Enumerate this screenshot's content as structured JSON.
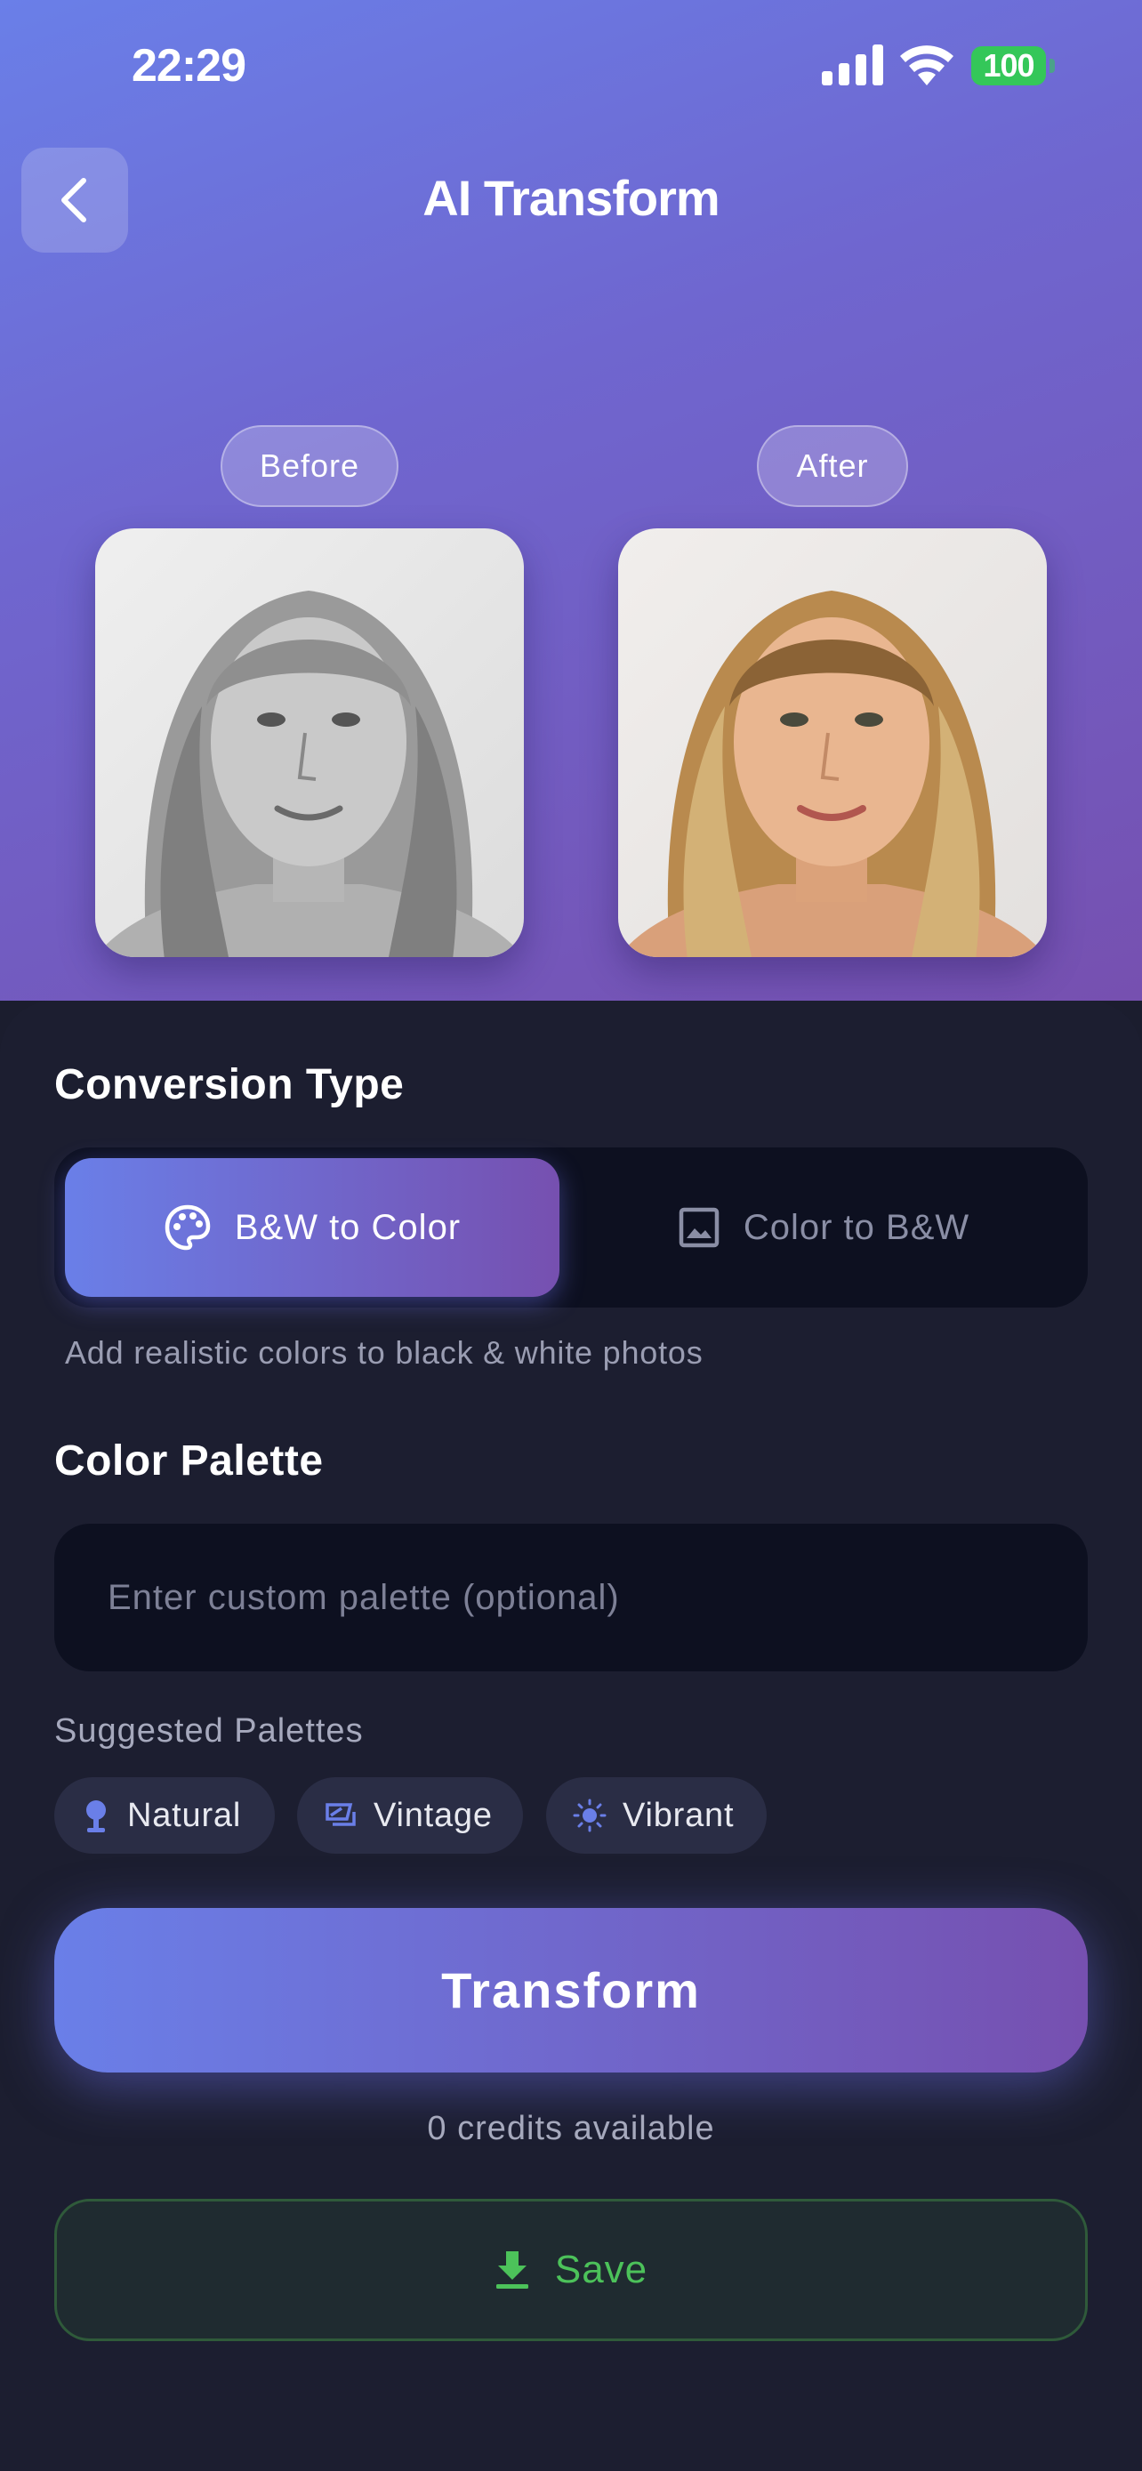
{
  "status_bar": {
    "time": "22:29",
    "battery": "100",
    "icons": [
      "signal-icon",
      "wifi-icon",
      "battery-icon"
    ]
  },
  "header": {
    "title": "AI Transform",
    "back_icon": "chevron-left-icon"
  },
  "preview": {
    "before_label": "Before",
    "after_label": "After"
  },
  "conversion": {
    "title": "Conversion Type",
    "options": [
      {
        "label": "B&W to Color",
        "icon": "palette-icon",
        "selected": true
      },
      {
        "label": "Color to B&W",
        "icon": "image-icon",
        "selected": false
      }
    ],
    "description": "Add realistic colors to black & white photos"
  },
  "palette": {
    "title": "Color Palette",
    "input_placeholder": "Enter custom palette (optional)",
    "input_value": "",
    "suggested_label": "Suggested Palettes",
    "suggestions": [
      {
        "label": "Natural",
        "icon": "pin-icon"
      },
      {
        "label": "Vintage",
        "icon": "vintage-icon"
      },
      {
        "label": "Vibrant",
        "icon": "sun-icon"
      }
    ]
  },
  "actions": {
    "transform_label": "Transform",
    "credits_text": "0 credits available",
    "save_label": "Save",
    "save_icon": "download-icon"
  },
  "colors": {
    "accent_start": "#6a7fe8",
    "accent_end": "#7650b0",
    "panel_bg": "#1c1e30",
    "input_bg": "#0d1020",
    "save_green": "#4cc25a",
    "battery_green": "#34c759"
  }
}
